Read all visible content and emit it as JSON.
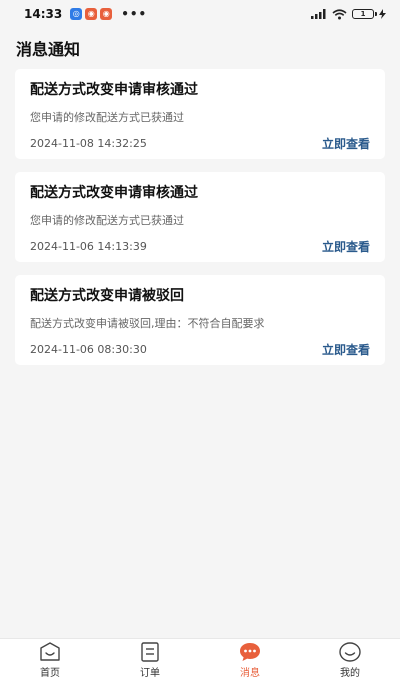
{
  "status_bar": {
    "time": "14:33",
    "dots": "•••",
    "battery": "1"
  },
  "page": {
    "title": "消息通知"
  },
  "messages": [
    {
      "title": "配送方式改变申请审核通过",
      "desc": "您申请的修改配送方式已获通过",
      "time": "2024-11-08 14:32:25",
      "action": "立即查看"
    },
    {
      "title": "配送方式改变申请审核通过",
      "desc": "您申请的修改配送方式已获通过",
      "time": "2024-11-06 14:13:39",
      "action": "立即查看"
    },
    {
      "title": "配送方式改变申请被驳回",
      "desc": "配送方式改变申请被驳回,理由：不符合自配要求",
      "time": "2024-11-06 08:30:30",
      "action": "立即查看"
    }
  ],
  "tabs": [
    {
      "label": "首页",
      "icon": "home-icon"
    },
    {
      "label": "订单",
      "icon": "order-icon"
    },
    {
      "label": "消息",
      "icon": "message-icon"
    },
    {
      "label": "我的",
      "icon": "profile-icon"
    }
  ],
  "colors": {
    "accent": "#e8603c",
    "link": "#2a5a8c",
    "background": "#f5f5f5"
  }
}
